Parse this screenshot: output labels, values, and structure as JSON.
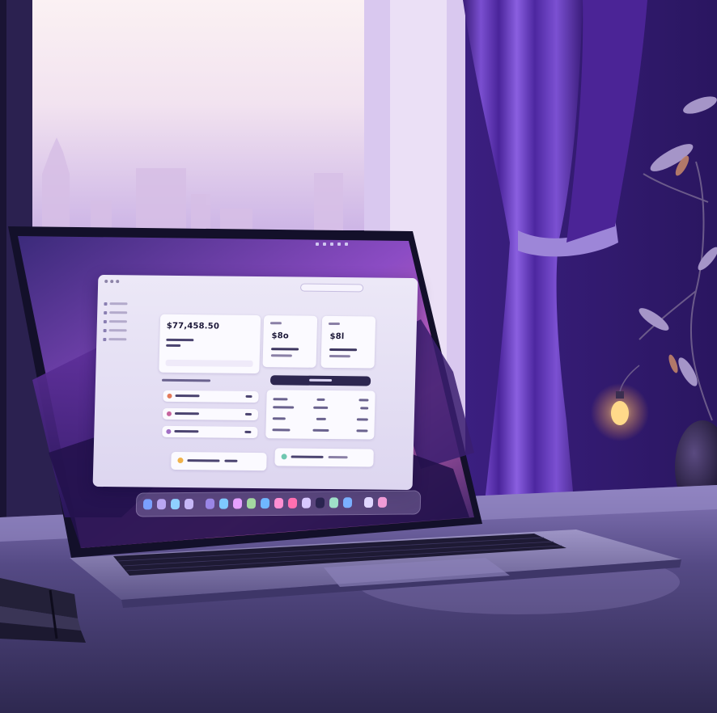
{
  "scene": {
    "description_colors": {
      "accent": "#6b3fc4",
      "curtain": "#5a2aa6",
      "desk": "#4a4173",
      "sky": "#f3e4f1"
    }
  },
  "screen": {
    "balance_amount": "$77,458.50",
    "card_a_value": "$8o",
    "card_b_value": "$8l",
    "search_placeholder": ""
  },
  "dock": {
    "icon_colors": [
      "#7aa0ff",
      "#b9a6f2",
      "#8fd0ff",
      "#c7b7f7",
      "#9a86e6",
      "#7ec8ff",
      "#e6a0ff",
      "#a3d8a0",
      "#6fb6ff",
      "#ff8fd2",
      "#ff6fb0",
      "#d8c8ff",
      "#2a2450",
      "#9fe0c8",
      "#7ab0ff",
      "#e0d6ff",
      "#f09bd6"
    ]
  }
}
